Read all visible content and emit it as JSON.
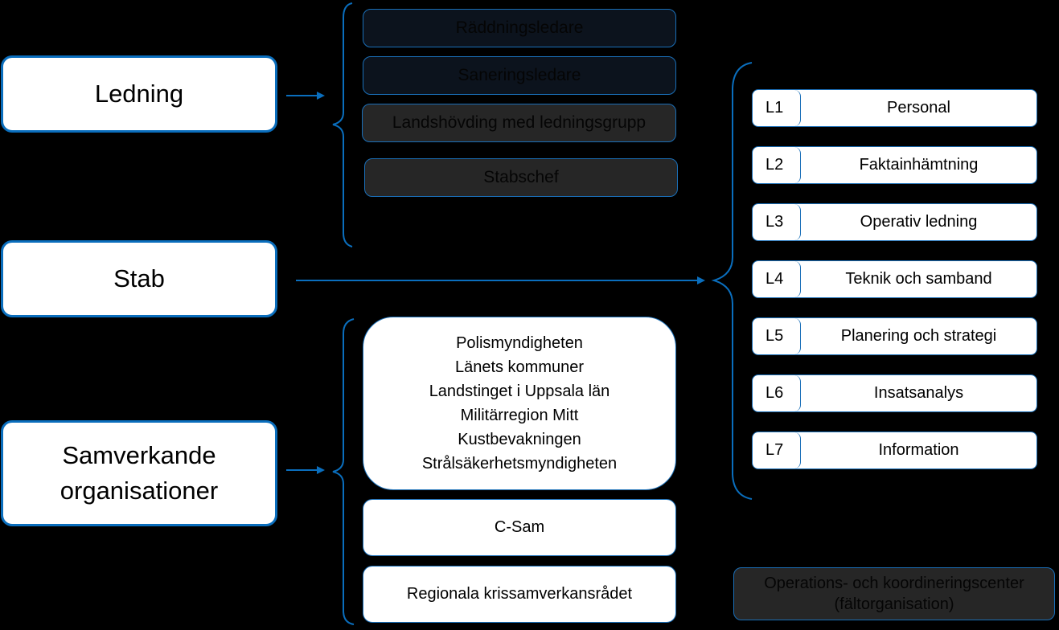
{
  "left_boxes": {
    "ledning": "Ledning",
    "stab": "Stab",
    "samverkande_line1": "Samverkande",
    "samverkande_line2": "organisationer"
  },
  "ledning_items": [
    "Räddningsledare",
    "Saneringsledare",
    "Landshövding med ledningsgrupp",
    "Stabschef"
  ],
  "samverkande_orgs": [
    "Polismyndigheten",
    "Länets kommuner",
    "Landstinget i Uppsala län",
    "Militärregion Mitt",
    "Kustbevakningen",
    "Strålsäkerhetsmyndigheten"
  ],
  "samverkande_other": [
    "C-Sam",
    "Regionala krissamverkansrådet"
  ],
  "stab_functions": [
    {
      "code": "L1",
      "label": "Personal"
    },
    {
      "code": "L2",
      "label": "Faktainhämtning"
    },
    {
      "code": "L3",
      "label": "Operativ ledning"
    },
    {
      "code": "L4",
      "label": "Teknik och samband"
    },
    {
      "code": "L5",
      "label": "Planering och strategi"
    },
    {
      "code": "L6",
      "label": "Insatsanalys"
    },
    {
      "code": "L7",
      "label": "Information"
    }
  ],
  "field_org": {
    "line1": "Operations- och koordineringscenter",
    "line2": "(fältorganisation)"
  },
  "colors": {
    "accent": "#0a6ebd",
    "background": "#000000",
    "box_fill": "#ffffff",
    "dim_fill_dark": "#0c131d",
    "dim_fill_gray": "#262626"
  }
}
